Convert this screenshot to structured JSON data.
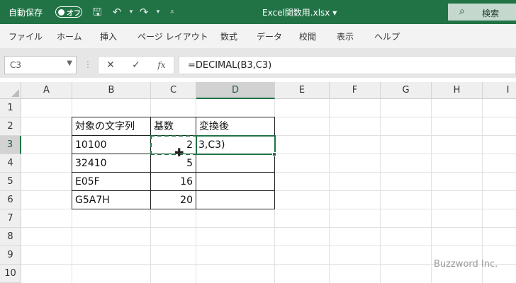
{
  "titlebar": {
    "autosave_label": "自動保存",
    "autosave_state": "オフ",
    "filename": "Excel関数用.xlsx ▾",
    "search_label": "検索"
  },
  "ribbon": {
    "tabs": [
      "ファイル",
      "ホーム",
      "挿入",
      "ページ レイアウト",
      "数式",
      "データ",
      "校閲",
      "表示",
      "ヘルプ"
    ]
  },
  "formula_bar": {
    "name_box": "C3",
    "fx_label": "fx",
    "formula": "=DECIMAL(B3,C3)"
  },
  "columns": [
    "A",
    "B",
    "C",
    "D",
    "E",
    "F",
    "G",
    "H",
    "I"
  ],
  "active_column": "D",
  "rows": [
    "1",
    "2",
    "3",
    "4",
    "5",
    "6",
    "7",
    "8",
    "9",
    "10"
  ],
  "active_row": "3",
  "table": {
    "headers": [
      "対象の文字列",
      "基数",
      "変換後"
    ],
    "rows": [
      {
        "text": "10100",
        "base": "2",
        "result": "3,C3)"
      },
      {
        "text": "32410",
        "base": "5",
        "result": ""
      },
      {
        "text": "E05F",
        "base": "16",
        "result": ""
      },
      {
        "text": "G5A7H",
        "base": "20",
        "result": ""
      }
    ]
  },
  "watermark": "Buzzword Inc.",
  "colors": {
    "accent": "#217346",
    "header_bg": "#efefef"
  }
}
